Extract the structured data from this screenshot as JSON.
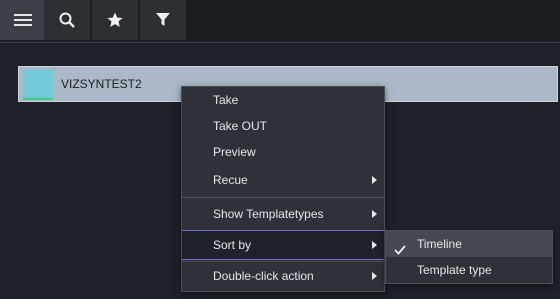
{
  "toolbar": {
    "buttons": [
      {
        "icon": "hamburger-menu-icon"
      },
      {
        "icon": "search-icon"
      },
      {
        "icon": "star-icon"
      },
      {
        "icon": "filter-icon"
      }
    ]
  },
  "list": {
    "items": [
      {
        "title": "VIZSYNTEST2"
      }
    ]
  },
  "context_menu": {
    "items": [
      {
        "label": "Take",
        "submenu": false
      },
      {
        "label": "Take OUT",
        "submenu": false
      },
      {
        "label": "Preview",
        "submenu": false
      },
      {
        "label": "Recue",
        "submenu": true
      },
      {
        "label": "Show Templatetypes",
        "submenu": true
      },
      {
        "label": "Sort by",
        "submenu": true,
        "highlighted": true
      },
      {
        "label": "Double-click action",
        "submenu": true
      }
    ]
  },
  "sort_submenu": {
    "items": [
      {
        "label": "Timeline",
        "checked": true
      },
      {
        "label": "Template type",
        "checked": false
      }
    ]
  },
  "colors": {
    "accent": "#6a72d8",
    "item_background": "#aab8c8",
    "thumbnail": "#71c9dc"
  }
}
